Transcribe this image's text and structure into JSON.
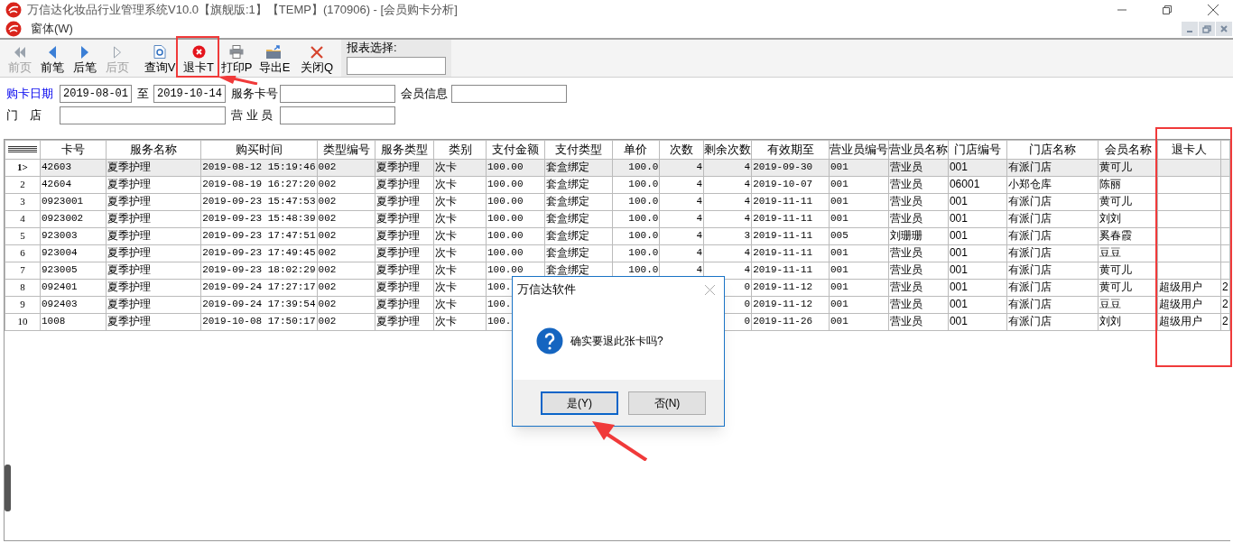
{
  "window": {
    "title": "万信达化妆品行业管理系统V10.0【旗舰版:1】【TEMP】(170906) - [会员购卡分析]"
  },
  "menu": [
    "窗体(W)"
  ],
  "toolbar": [
    {
      "label": "前页",
      "disabled": true
    },
    {
      "label": "前笔",
      "disabled": false
    },
    {
      "label": "后笔",
      "disabled": false
    },
    {
      "label": "后页",
      "disabled": true
    },
    {
      "label": "查询V",
      "disabled": false
    },
    {
      "label": "退卡T",
      "disabled": false
    },
    {
      "label": "打印P",
      "disabled": false
    },
    {
      "label": "导出E",
      "disabled": false
    },
    {
      "label": "关闭Q",
      "disabled": false
    }
  ],
  "report_select": {
    "label": "报表选择:"
  },
  "filters": {
    "date_label": "购卡日期",
    "date_from": "2019-08-01",
    "to_label": "至",
    "date_to": "2019-10-14",
    "card_label": "服务卡号",
    "member_label": "会员信息",
    "store_label": "门　店",
    "clerk_label": "营 业 员"
  },
  "table": {
    "columns": [
      "卡号",
      "服务名称",
      "购买时间",
      "类型编号",
      "服务类型",
      "类别",
      "支付金额",
      "支付类型",
      "单价",
      "次数",
      "剩余次数",
      "有效期至",
      "营业员编号",
      "营业员名称",
      "门店编号",
      "门店名称",
      "会员名称",
      "退卡人"
    ],
    "rows": [
      {
        "index": "1>",
        "selected": true,
        "cells": [
          "42603",
          "夏季护理",
          "2019-08-12 15:19:46",
          "002",
          "夏季护理",
          "次卡",
          "100.00",
          "套盒绑定",
          "100.0",
          "4",
          "4",
          "2019-09-30",
          "001",
          "营业员",
          "001",
          "有派门店",
          "黄可儿",
          null,
          null
        ]
      },
      {
        "index": "2",
        "selected": false,
        "cells": [
          "42604",
          "夏季护理",
          "2019-08-19 16:27:20",
          "002",
          "夏季护理",
          "次卡",
          "100.00",
          "套盒绑定",
          "100.0",
          "4",
          "4",
          "2019-10-07",
          "001",
          "营业员",
          "06001",
          "小郑仓库",
          "陈丽",
          null,
          null
        ]
      },
      {
        "index": "3",
        "selected": false,
        "cells": [
          "0923001",
          "夏季护理",
          "2019-09-23 15:47:53",
          "002",
          "夏季护理",
          "次卡",
          "100.00",
          "套盒绑定",
          "100.0",
          "4",
          "4",
          "2019-11-11",
          "001",
          "营业员",
          "001",
          "有派门店",
          "黄可儿",
          null,
          null
        ]
      },
      {
        "index": "4",
        "selected": false,
        "cells": [
          "0923002",
          "夏季护理",
          "2019-09-23 15:48:39",
          "002",
          "夏季护理",
          "次卡",
          "100.00",
          "套盒绑定",
          "100.0",
          "4",
          "4",
          "2019-11-11",
          "001",
          "营业员",
          "001",
          "有派门店",
          "刘刘",
          null,
          null
        ]
      },
      {
        "index": "5",
        "selected": false,
        "cells": [
          "923003",
          "夏季护理",
          "2019-09-23 17:47:51",
          "002",
          "夏季护理",
          "次卡",
          "100.00",
          "套盒绑定",
          "100.0",
          "4",
          "3",
          "2019-11-11",
          "005",
          "刘珊珊",
          "001",
          "有派门店",
          "奚春霞",
          null,
          null
        ]
      },
      {
        "index": "6",
        "selected": false,
        "cells": [
          "923004",
          "夏季护理",
          "2019-09-23 17:49:45",
          "002",
          "夏季护理",
          "次卡",
          "100.00",
          "套盒绑定",
          "100.0",
          "4",
          "4",
          "2019-11-11",
          "001",
          "营业员",
          "001",
          "有派门店",
          "豆豆",
          null,
          null
        ]
      },
      {
        "index": "7",
        "selected": false,
        "cells": [
          "923005",
          "夏季护理",
          "2019-09-23 18:02:29",
          "002",
          "夏季护理",
          "次卡",
          "100.00",
          "套盒绑定",
          "100.0",
          "4",
          "4",
          "2019-11-11",
          "001",
          "营业员",
          "001",
          "有派门店",
          "黄可儿",
          null,
          null
        ]
      },
      {
        "index": "8",
        "selected": false,
        "cells": [
          "092401",
          "夏季护理",
          "2019-09-24 17:27:17",
          "002",
          "夏季护理",
          "次卡",
          "100.",
          null,
          null,
          null,
          "0",
          "2019-11-12",
          "001",
          "营业员",
          "001",
          "有派门店",
          "黄可儿",
          "超级用户",
          "2"
        ]
      },
      {
        "index": "9",
        "selected": false,
        "cells": [
          "092403",
          "夏季护理",
          "2019-09-24 17:39:54",
          "002",
          "夏季护理",
          "次卡",
          "100.",
          null,
          null,
          null,
          "0",
          "2019-11-12",
          "001",
          "营业员",
          "001",
          "有派门店",
          "豆豆",
          "超级用户",
          "2"
        ]
      },
      {
        "index": "10",
        "selected": false,
        "cells": [
          "1008",
          "夏季护理",
          "2019-10-08 17:50:17",
          "002",
          "夏季护理",
          "次卡",
          "100.",
          null,
          null,
          null,
          "0",
          "2019-11-26",
          "001",
          "营业员",
          "001",
          "有派门店",
          "刘刘",
          "超级用户",
          "2"
        ]
      }
    ]
  },
  "dialog": {
    "title": "万信达软件",
    "message": "确实要退此张卡吗?",
    "buttons": [
      {
        "label": "是(Y)",
        "selected": true
      },
      {
        "label": "否(N)",
        "selected": false
      }
    ]
  }
}
